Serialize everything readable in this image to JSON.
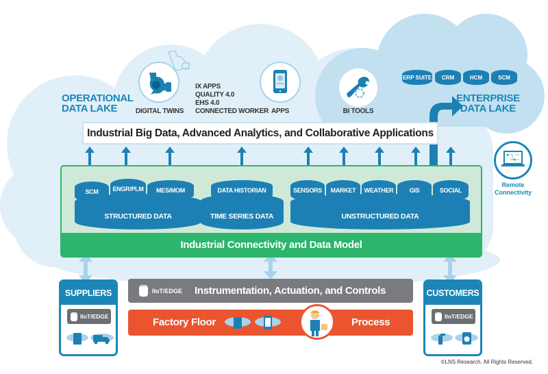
{
  "operational_lake": {
    "line1": "OPERATIONAL",
    "line2": "DATA LAKE"
  },
  "enterprise_lake": {
    "line1": "ENTERPRISE",
    "line2": "DATA LAKE"
  },
  "top_icons": {
    "digital_twins": {
      "label": "DIGITAL TWINS",
      "icon": "pump-icon"
    },
    "apps_list": [
      "IX APPS",
      "QUALITY 4.0",
      "EHS 4.0",
      "CONNECTED WORKER"
    ],
    "apps": {
      "label": "APPS",
      "icon": "tablet-icon"
    },
    "bi_tools": {
      "label": "BI TOOLS",
      "icon": "wrench-gear-icon"
    }
  },
  "enterprise_dbs": [
    "ERP SUITE",
    "CRM",
    "HCM",
    "SCM"
  ],
  "big_data_bar": "Industrial Big Data, Advanced Analytics, and Collaborative Applications",
  "structured": {
    "label": "STRUCTURED DATA",
    "items": [
      "SCM",
      "ENGR/PLM",
      "MES/MOM"
    ]
  },
  "time_series": {
    "label": "TIME SERIES DATA",
    "items": [
      "DATA HISTORIAN"
    ]
  },
  "unstructured": {
    "label": "UNSTRUCTURED DATA",
    "items": [
      "SENSORS",
      "MARKET",
      "WEATHER",
      "GIS",
      "SOCIAL"
    ]
  },
  "connectivity_band": "Industrial Connectivity and Data Model",
  "remote": {
    "line1": "Remote",
    "line2": "Connectivity",
    "icon": "laptop-network-icon"
  },
  "suppliers": {
    "title": "SUPPLIERS",
    "chip": "IIoT/EDGE"
  },
  "customers": {
    "title": "CUSTOMERS",
    "chip": "IIoT/EDGE"
  },
  "instrumentation": {
    "chip": "IIoT/EDGE",
    "label": "Instrumentation, Actuation, and Controls"
  },
  "factory": {
    "left": "Factory Floor",
    "right": "Process"
  },
  "copyright": "©LNS Research. All Rights Reserved.",
  "colors": {
    "blue": "#1d80b4",
    "green": "#2db56b",
    "orange": "#ea5530",
    "gray": "#7a7b7e",
    "cloud_light": "#e1eff8",
    "cloud_mid": "#c3e0f1"
  }
}
